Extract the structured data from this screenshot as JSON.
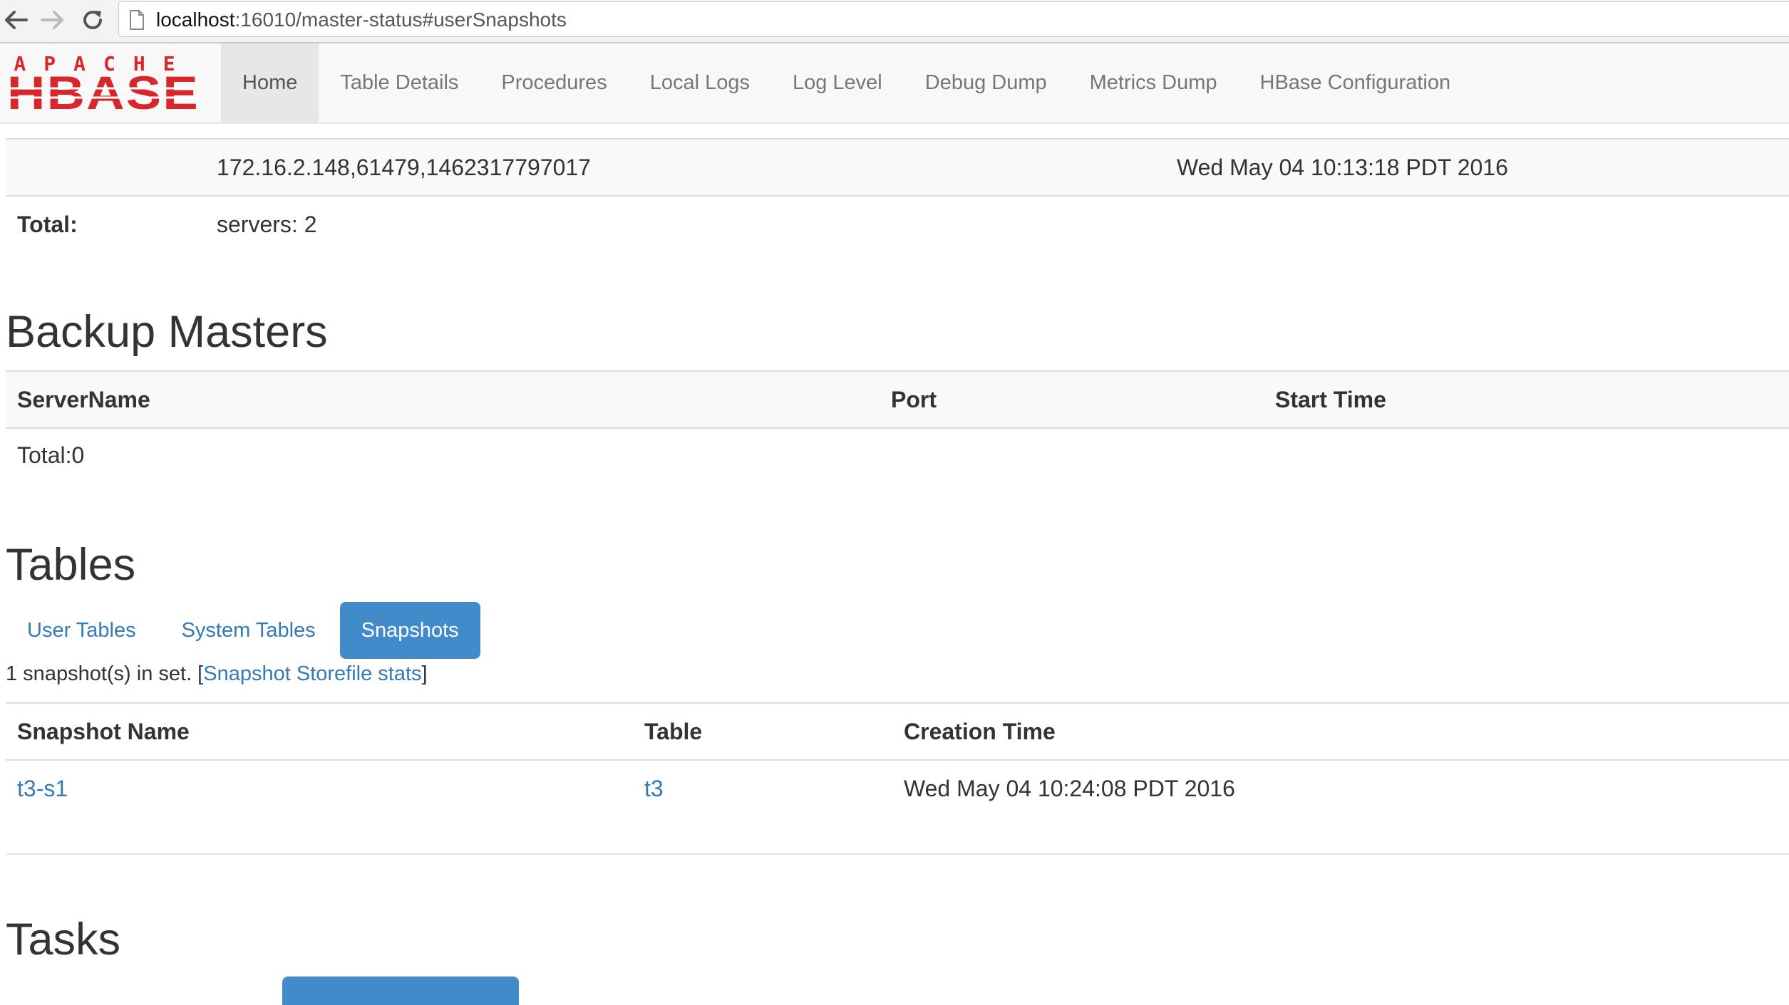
{
  "browser": {
    "url_host": "localhost",
    "url_path": ":16010/master-status#userSnapshots"
  },
  "logo": {
    "line1": "APACHE",
    "line2": "HBASE",
    "color": "#d8262a"
  },
  "nav": {
    "items": [
      "Home",
      "Table Details",
      "Procedures",
      "Local Logs",
      "Log Level",
      "Debug Dump",
      "Metrics Dump",
      "HBase Configuration"
    ],
    "active": "Home"
  },
  "region_servers": {
    "row": {
      "server_name": "172.16.2.148,61479,1462317797017",
      "start_time": "Wed May 04 10:13:18 PDT 2016"
    },
    "total_label": "Total:",
    "total_value": "servers: 2"
  },
  "backup_masters": {
    "heading": "Backup Masters",
    "columns": [
      "ServerName",
      "Port",
      "Start Time"
    ],
    "total": "Total:0"
  },
  "tables": {
    "heading": "Tables",
    "tabs": [
      "User Tables",
      "System Tables",
      "Snapshots"
    ],
    "active_tab": "Snapshots",
    "snapshot_summary": {
      "prefix": "1 snapshot(s) in set. [",
      "link": "Snapshot Storefile stats",
      "suffix": "]"
    },
    "snapshot_columns": [
      "Snapshot Name",
      "Table",
      "Creation Time"
    ],
    "snapshots": [
      {
        "name": "t3-s1",
        "table": "t3",
        "creation_time": "Wed May 04 10:24:08 PDT 2016"
      }
    ]
  },
  "tasks": {
    "heading": "Tasks"
  },
  "colors": {
    "link": "#337ab7",
    "active_tab": "#428bca",
    "navbar_bg": "#f8f8f8"
  }
}
